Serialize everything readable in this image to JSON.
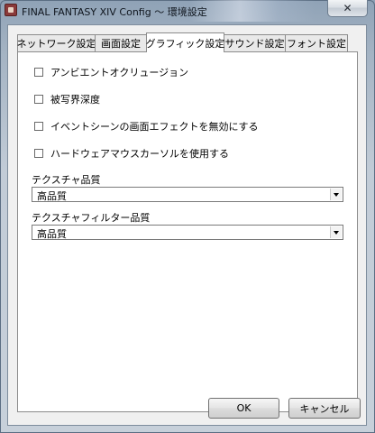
{
  "window": {
    "title": "FINAL FANTASY XIV Config ～ 環境設定",
    "close_label": "✕"
  },
  "tabs": [
    {
      "label": "ネットワーク設定",
      "active": false
    },
    {
      "label": "画面設定",
      "active": false
    },
    {
      "label": "グラフィック設定",
      "active": true
    },
    {
      "label": "サウンド設定",
      "active": false
    },
    {
      "label": "フォント設定",
      "active": false
    }
  ],
  "graphics": {
    "options": [
      {
        "label": "アンビエントオクリュージョン",
        "checked": false
      },
      {
        "label": "被写界深度",
        "checked": false
      },
      {
        "label": "イベントシーンの画面エフェクトを無効にする",
        "checked": false
      },
      {
        "label": "ハードウェアマウスカーソルを使用する",
        "checked": false
      }
    ],
    "texture_quality": {
      "label": "テクスチャ品質",
      "value": "高品質"
    },
    "texture_filter_quality": {
      "label": "テクスチャフィルター品質",
      "value": "高品質"
    }
  },
  "buttons": {
    "ok": "OK",
    "cancel": "キャンセル"
  }
}
